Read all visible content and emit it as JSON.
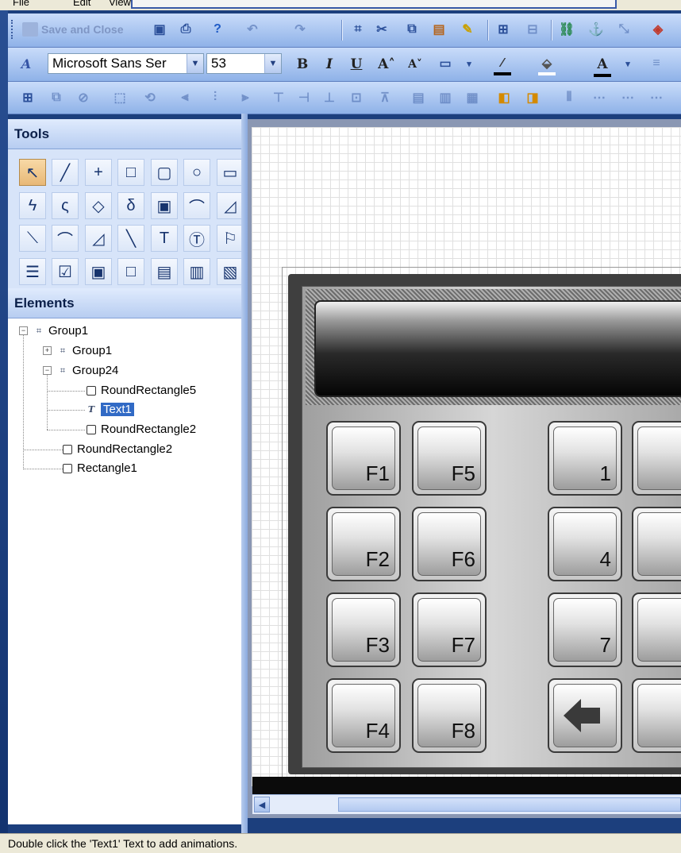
{
  "menu": {
    "items": [
      "File",
      "Edit",
      "View"
    ]
  },
  "toolbar1": {
    "save_close_label": "Save and Close",
    "icons": [
      "save-icon",
      "print-preview-icon",
      "help-icon",
      "undo-icon",
      "redo-icon",
      "select-all-icon",
      "cut-icon",
      "copy-icon",
      "paste-icon",
      "format-painter-icon",
      "group-icon",
      "ungroup-icon",
      "link-icon",
      "anchor-icon",
      "connect-icon",
      "color-icon"
    ]
  },
  "toolbar2": {
    "font_family": "Microsoft Sans Ser",
    "font_size": "53",
    "bold_label": "B",
    "italic_label": "I",
    "underline_label": "U",
    "grow_font_label": "A˄",
    "shrink_font_label": "A˅",
    "font_color_label": "A"
  },
  "toolbar3": {
    "icons": [
      "group-icon",
      "ungroup-icon",
      "align-left-icon",
      "align-center-icon",
      "align-right-icon",
      "align-top-icon",
      "align-middle-icon",
      "align-bottom-icon",
      "bring-front-icon",
      "send-back-icon",
      "distribute-icon"
    ]
  },
  "tools": {
    "title": "Tools",
    "items": [
      {
        "name": "pointer",
        "glyph": "↖"
      },
      {
        "name": "line",
        "glyph": "╱"
      },
      {
        "name": "cross",
        "glyph": "+"
      },
      {
        "name": "rectangle",
        "glyph": "□"
      },
      {
        "name": "round-rectangle",
        "glyph": "▢"
      },
      {
        "name": "ellipse",
        "glyph": "○"
      },
      {
        "name": "rounded-box",
        "glyph": "▭"
      },
      {
        "name": "polyline",
        "glyph": "ϟ"
      },
      {
        "name": "curve",
        "glyph": "ς"
      },
      {
        "name": "polygon",
        "glyph": "◇"
      },
      {
        "name": "closed-curve",
        "glyph": "δ"
      },
      {
        "name": "image",
        "glyph": "▣"
      },
      {
        "name": "arc",
        "glyph": "⌒"
      },
      {
        "name": "pie",
        "glyph": "◿"
      },
      {
        "name": "bezier",
        "glyph": "⟍"
      },
      {
        "name": "arc2",
        "glyph": "⌒"
      },
      {
        "name": "chord",
        "glyph": "◿"
      },
      {
        "name": "pie2",
        "glyph": "╲"
      },
      {
        "name": "text",
        "glyph": "T"
      },
      {
        "name": "text-box",
        "glyph": "Ⓣ"
      },
      {
        "name": "symbol",
        "glyph": "⚐"
      },
      {
        "name": "list",
        "glyph": "☰"
      },
      {
        "name": "checkbox",
        "glyph": "☑"
      },
      {
        "name": "button",
        "glyph": "▣"
      },
      {
        "name": "frame",
        "glyph": "□"
      },
      {
        "name": "window",
        "glyph": "▤"
      },
      {
        "name": "panel",
        "glyph": "▥"
      },
      {
        "name": "gauge",
        "glyph": "▧"
      }
    ]
  },
  "elements": {
    "title": "Elements",
    "tree": [
      {
        "label": "Group1",
        "toggle": "−",
        "icon": "group"
      },
      {
        "label": "Group1",
        "toggle": "+",
        "icon": "group"
      },
      {
        "label": "Group24",
        "toggle": "−",
        "icon": "group"
      },
      {
        "label": "RoundRectangle5",
        "icon": "rect"
      },
      {
        "label": "Text1",
        "icon": "text",
        "selected": true
      },
      {
        "label": "RoundRectangle2",
        "icon": "rect"
      },
      {
        "label": "RoundRectangle2",
        "icon": "rect"
      },
      {
        "label": "Rectangle1",
        "icon": "rect"
      }
    ]
  },
  "canvas": {
    "keys": [
      {
        "label": "F1"
      },
      {
        "label": "F5"
      },
      {
        "label": "1"
      },
      {
        "label": "F2"
      },
      {
        "label": "F6"
      },
      {
        "label": "4"
      },
      {
        "label": "F3"
      },
      {
        "label": "F7"
      },
      {
        "label": "7"
      },
      {
        "label": "F4"
      },
      {
        "label": "F8"
      },
      {
        "label": "",
        "icon": "backspace-arrow-icon"
      }
    ]
  },
  "status": {
    "text": "Double click the 'Text1' Text to add animations."
  },
  "colors": {
    "toolbar": "#a9c5f0",
    "selection": "#316ac5",
    "tool_selected": "#e8b877"
  }
}
